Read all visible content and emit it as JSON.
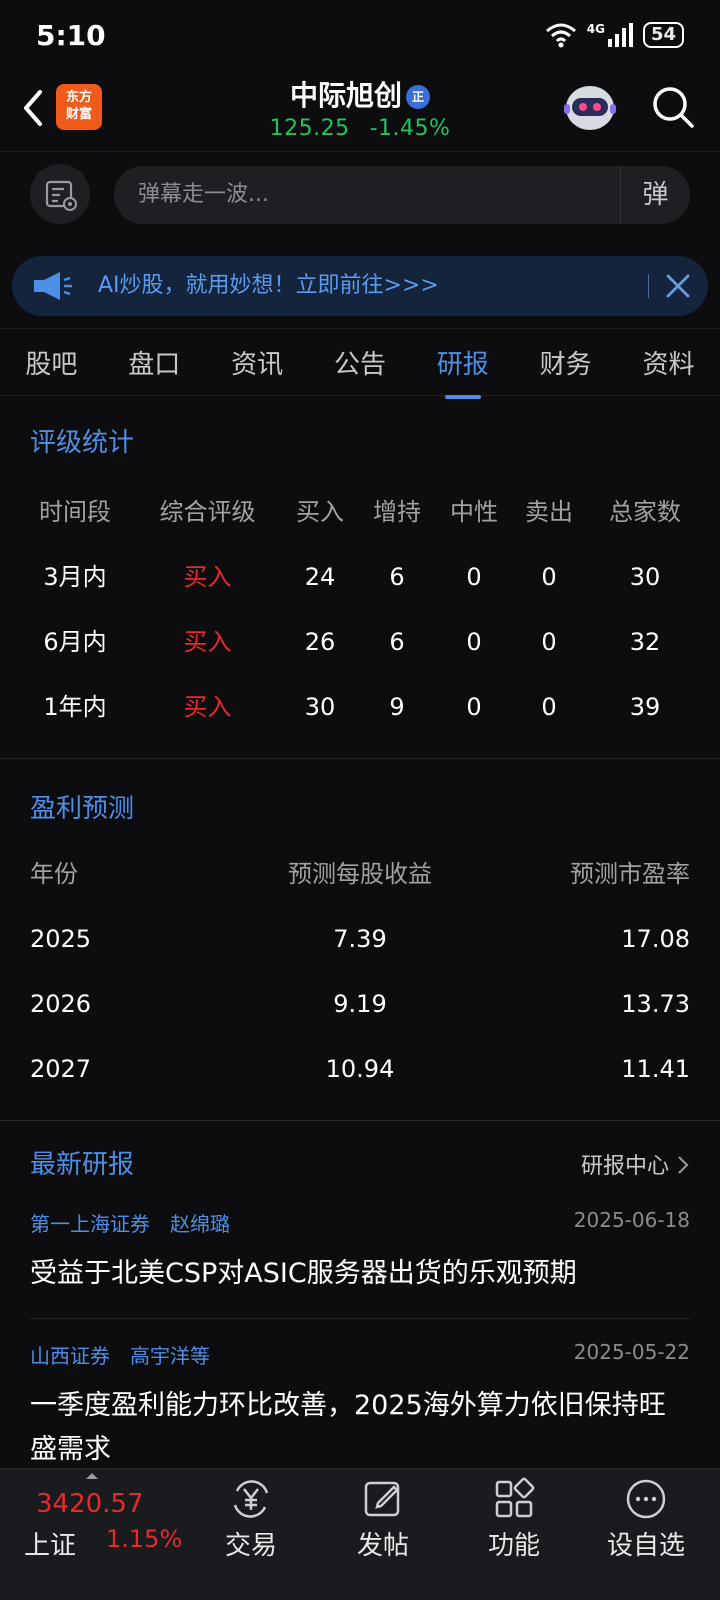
{
  "status_bar": {
    "time": "5:10",
    "network": "4G",
    "battery": "54"
  },
  "header": {
    "logo_text_line1": "东方",
    "logo_text_line2": "财富",
    "stock_name": "中际旭创",
    "badge": "正",
    "price": "125.25",
    "change_pct": "-1.45%"
  },
  "barrage": {
    "placeholder": "弹幕走一波...",
    "toggle_label": "弹"
  },
  "ai_banner": {
    "text": "AI炒股，就用妙想！立即前往>>>"
  },
  "tabs": [
    {
      "label": "股吧"
    },
    {
      "label": "盘口"
    },
    {
      "label": "资讯"
    },
    {
      "label": "公告"
    },
    {
      "label": "研报",
      "active": true
    },
    {
      "label": "财务"
    },
    {
      "label": "资料"
    }
  ],
  "rating": {
    "title": "评级统计",
    "headers": [
      "时间段",
      "综合评级",
      "买入",
      "增持",
      "中性",
      "卖出",
      "总家数"
    ],
    "rows": [
      [
        "3月内",
        "买入",
        "24",
        "6",
        "0",
        "0",
        "30"
      ],
      [
        "6月内",
        "买入",
        "26",
        "6",
        "0",
        "0",
        "32"
      ],
      [
        "1年内",
        "买入",
        "30",
        "9",
        "0",
        "0",
        "39"
      ]
    ]
  },
  "forecast": {
    "title": "盈利预测",
    "headers": [
      "年份",
      "预测每股收益",
      "预测市盈率"
    ],
    "rows": [
      [
        "2025",
        "7.39",
        "17.08"
      ],
      [
        "2026",
        "9.19",
        "13.73"
      ],
      [
        "2027",
        "10.94",
        "11.41"
      ]
    ]
  },
  "reports": {
    "title": "最新研报",
    "center_link": "研报中心",
    "items": [
      {
        "org": "第一上海证券",
        "author": "赵绵璐",
        "date": "2025-06-18",
        "title": "受益于北美CSP对ASIC服务器出货的乐观预期"
      },
      {
        "org": "山西证券",
        "author": "高宇洋等",
        "date": "2025-05-22",
        "title": "一季度盈利能力环比改善，2025海外算力依旧保持旺盛需求"
      }
    ]
  },
  "bottom_nav": {
    "index_value": "3420.57",
    "index_name": "上证",
    "index_pct": "1.15%",
    "items": [
      {
        "label": "交易",
        "icon": "yen-cycle-icon"
      },
      {
        "label": "发帖",
        "icon": "edit-post-icon"
      },
      {
        "label": "功能",
        "icon": "grid-apps-icon"
      },
      {
        "label": "设自选",
        "icon": "more-dots-icon"
      }
    ]
  },
  "colors": {
    "accent": "#4d8fe6",
    "rise": "#e62a2a",
    "fall": "#22c35e"
  }
}
